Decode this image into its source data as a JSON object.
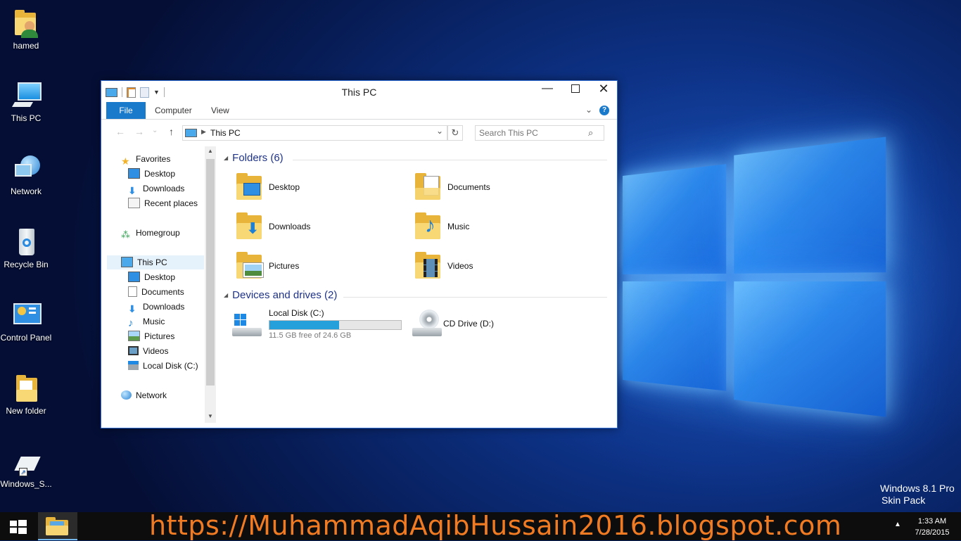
{
  "desktop": {
    "icons": [
      {
        "label": "hamed",
        "icon": "user-folder-icon"
      },
      {
        "label": "This PC",
        "icon": "computer-icon"
      },
      {
        "label": "Network",
        "icon": "network-globe-icon"
      },
      {
        "label": "Recycle Bin",
        "icon": "recycle-bin-icon"
      },
      {
        "label": "Control Panel",
        "icon": "control-panel-icon"
      },
      {
        "label": "New folder",
        "icon": "folder-icon"
      },
      {
        "label": "Windows_S...",
        "icon": "shortcut-icon"
      }
    ],
    "watermark_line1": "Windows 8.1 Pro",
    "watermark_line2": "Skin Pack"
  },
  "window": {
    "title": "This PC",
    "ribbon_tabs": [
      "File",
      "Computer",
      "View"
    ],
    "address": "This PC",
    "search_placeholder": "Search This PC",
    "nav": {
      "favorites": "Favorites",
      "fav_items": [
        "Desktop",
        "Downloads",
        "Recent places"
      ],
      "homegroup": "Homegroup",
      "this_pc": "This PC",
      "pc_items": [
        "Desktop",
        "Documents",
        "Downloads",
        "Music",
        "Pictures",
        "Videos",
        "Local Disk (C:)"
      ],
      "network": "Network"
    },
    "folders_header": "Folders (6)",
    "folders": [
      "Desktop",
      "Documents",
      "Downloads",
      "Music",
      "Pictures",
      "Videos"
    ],
    "drives_header": "Devices and drives (2)",
    "drives": [
      {
        "name": "Local Disk (C:)",
        "free": "11.5 GB free of 24.6 GB",
        "used_fraction": 0.53
      },
      {
        "name": "CD Drive (D:)"
      }
    ]
  },
  "taskbar": {
    "url": "https://MuhammadAqibHussain2016.blogspot.com",
    "time": "1:33 AM",
    "date": "7/28/2015",
    "tray_arrow": "▲"
  },
  "colors": {
    "accent": "#1979ca",
    "progress": "#26a0da",
    "url": "#f07b22"
  }
}
